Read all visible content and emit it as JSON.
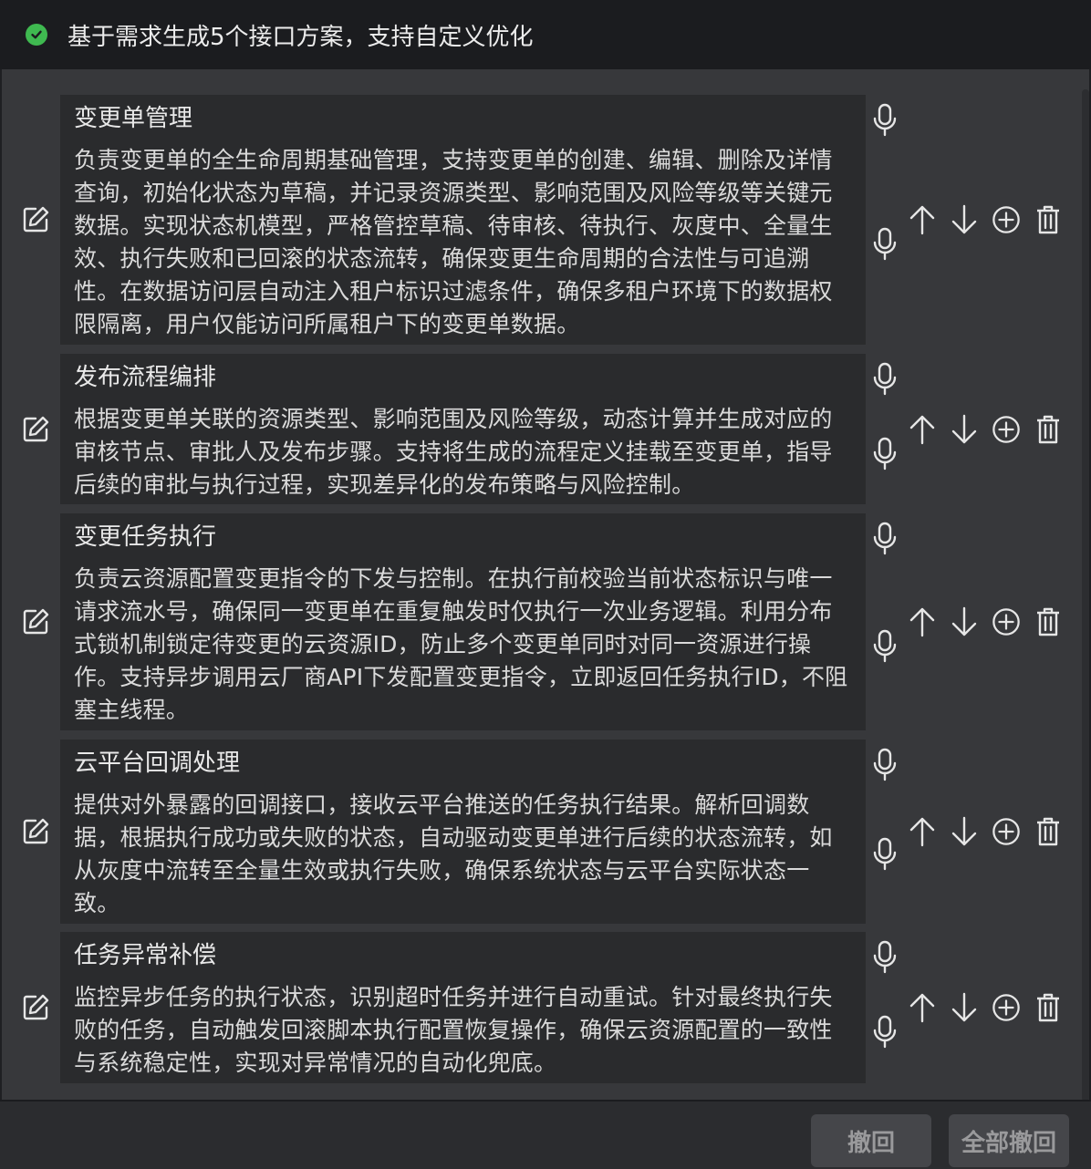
{
  "header": {
    "title": "基于需求生成5个接口方案，支持自定义优化"
  },
  "items": [
    {
      "name": "变更单管理",
      "description": "负责变更单的全生命周期基础管理，支持变更单的创建、编辑、删除及详情查询，初始化状态为草稿，并记录资源类型、影响范围及风险等级等关键元数据。实现状态机模型，严格管控草稿、待审核、待执行、灰度中、全量生效、执行失败和已回滚的状态流转，确保变更生命周期的合法性与可追溯性。在数据访问层自动注入租户标识过滤条件，确保多租户环境下的数据权限隔离，用户仅能访问所属租户下的变更单数据。"
    },
    {
      "name": "发布流程编排",
      "description": "根据变更单关联的资源类型、影响范围及风险等级，动态计算并生成对应的审核节点、审批人及发布步骤。支持将生成的流程定义挂载至变更单，指导后续的审批与执行过程，实现差异化的发布策略与风险控制。"
    },
    {
      "name": "变更任务执行",
      "description": "负责云资源配置变更指令的下发与控制。在执行前校验当前状态标识与唯一请求流水号，确保同一变更单在重复触发时仅执行一次业务逻辑。利用分布式锁机制锁定待变更的云资源ID，防止多个变更单同时对同一资源进行操作。支持异步调用云厂商API下发配置变更指令，立即返回任务执行ID，不阻塞主线程。"
    },
    {
      "name": "云平台回调处理",
      "description": "提供对外暴露的回调接口，接收云平台推送的任务执行结果。解析回调数据，根据执行成功或失败的状态，自动驱动变更单进行后续的状态流转，如从灰度中流转至全量生效或执行失败，确保系统状态与云平台实际状态一致。"
    },
    {
      "name": "任务异常补偿",
      "description": "监控异步任务的执行状态，识别超时任务并进行自动重试。针对最终执行失败的任务，自动触发回滚脚本执行配置恢复操作，确保云资源配置的一致性与系统稳定性，实现对异常情况的自动化兜底。"
    }
  ],
  "footer": {
    "undo_label": "撤回",
    "undo_all_label": "全部撤回"
  },
  "colors": {
    "success": "#3fb950",
    "panel": "#37383b",
    "card": "#2a2b2d"
  }
}
